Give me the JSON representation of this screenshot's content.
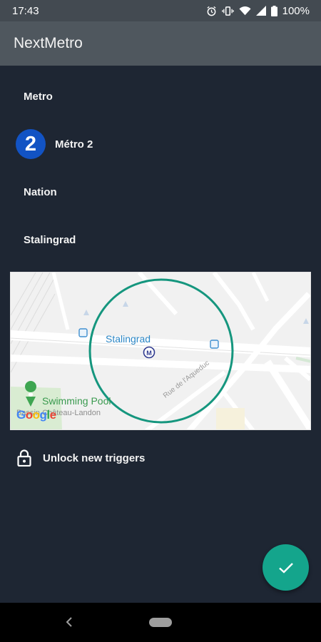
{
  "status_bar": {
    "time": "17:43",
    "battery": "100%",
    "icons": [
      "alarm-icon",
      "vibrate-icon",
      "wifi-icon",
      "signal-icon",
      "battery-icon"
    ]
  },
  "app_bar": {
    "title": "NextMetro"
  },
  "list": {
    "section_label": "Metro",
    "line_badge": "2",
    "line_label": "Métro 2",
    "origin_label": "Nation",
    "destination_label": "Stalingrad"
  },
  "map": {
    "station_label": "Stalingrad",
    "pool_label": "Swimming Pool",
    "street_label": "Bassin Château-Landon",
    "road_label": "Rue de l'Aqueduc",
    "brand": [
      "G",
      "o",
      "o",
      "g",
      "l",
      "e"
    ]
  },
  "unlock": {
    "label": "Unlock new triggers"
  },
  "colors": {
    "background": "#1e2633",
    "app_bar": "#4f575e",
    "line_badge": "#1253c4",
    "geofence": "#15967e",
    "fab": "#14a58c"
  }
}
